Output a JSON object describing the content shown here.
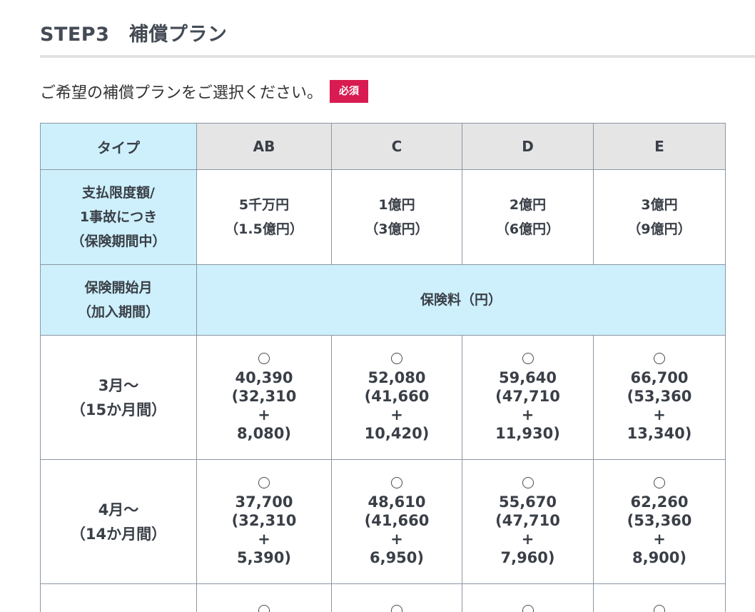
{
  "step": {
    "title": "STEP3　補償プラン"
  },
  "instruction": {
    "text": "ご希望の補償プランをご選択ください。",
    "required_badge": "必須"
  },
  "table": {
    "type_header": "タイプ",
    "plans": [
      "AB",
      "C",
      "D",
      "E"
    ],
    "limit_label": [
      "支払限度額/",
      "1事故につき",
      "（保険期間中）"
    ],
    "limits": [
      {
        "main": "5千万円",
        "sub": "（1.5億円）"
      },
      {
        "main": "1億円",
        "sub": "（3億円）"
      },
      {
        "main": "2億円",
        "sub": "（6億円）"
      },
      {
        "main": "3億円",
        "sub": "（9億円）"
      }
    ],
    "start_label": [
      "保険開始月",
      "（加入期間）"
    ],
    "premium_header": "保険料（円）",
    "rows": [
      {
        "month": "3月～",
        "period": "（15か月間）",
        "premiums": [
          {
            "total": "40,390",
            "base": "(32,310",
            "plus": "+",
            "extra": "8,080)"
          },
          {
            "total": "52,080",
            "base": "(41,660",
            "plus": "+",
            "extra": "10,420)"
          },
          {
            "total": "59,640",
            "base": "(47,710",
            "plus": "+",
            "extra": "11,930)"
          },
          {
            "total": "66,700",
            "base": "(53,360",
            "plus": "+",
            "extra": "13,340)"
          }
        ]
      },
      {
        "month": "4月～",
        "period": "（14か月間）",
        "premiums": [
          {
            "total": "37,700",
            "base": "(32,310",
            "plus": "+",
            "extra": "5,390)"
          },
          {
            "total": "48,610",
            "base": "(41,660",
            "plus": "+",
            "extra": "6,950)"
          },
          {
            "total": "55,670",
            "base": "(47,710",
            "plus": "+",
            "extra": "7,960)"
          },
          {
            "total": "62,260",
            "base": "(53,360",
            "plus": "+",
            "extra": "8,900)"
          }
        ]
      }
    ]
  },
  "colors": {
    "accent_blue": "#cdf0fc",
    "header_gray": "#e5e5e5",
    "required_red": "#d81b50",
    "border": "#8b96a3"
  }
}
